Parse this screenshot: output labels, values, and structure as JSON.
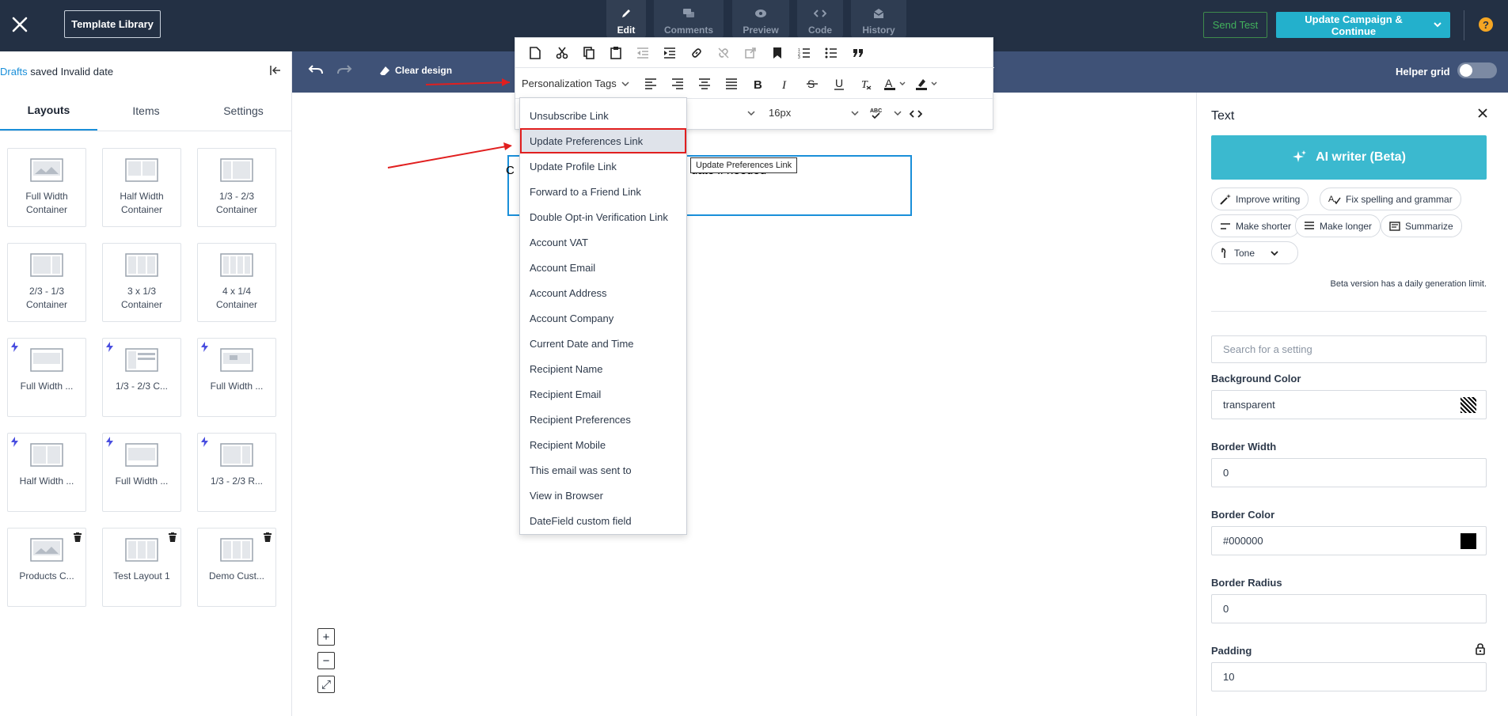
{
  "topbar": {
    "library_label": "Template Library",
    "tabs": [
      {
        "label": "Edit",
        "icon": "pencil-icon"
      },
      {
        "label": "Comments",
        "icon": "comments-icon"
      },
      {
        "label": "Preview",
        "icon": "eye-icon"
      },
      {
        "label": "Code",
        "icon": "code-icon"
      },
      {
        "label": "History",
        "icon": "history-icon"
      }
    ],
    "send_test_label": "Send Test",
    "update_label": "Update Campaign & Continue",
    "help_label": "?"
  },
  "left": {
    "drafts_link": "Drafts",
    "drafts_status": " saved Invalid date",
    "tabs": [
      "Layouts",
      "Items",
      "Settings"
    ],
    "cards": [
      {
        "name": "Full Width Container",
        "lines": [
          "Full Width",
          "Container"
        ]
      },
      {
        "name": "Half Width Container",
        "lines": [
          "Half Width",
          "Container"
        ]
      },
      {
        "name": "1/3 - 2/3 Container",
        "lines": [
          "1/3 - 2/3",
          "Container"
        ]
      },
      {
        "name": "2/3 - 1/3 Container",
        "lines": [
          "2/3 - 1/3",
          "Container"
        ]
      },
      {
        "name": "3 x 1/3 Container",
        "lines": [
          "3 x 1/3",
          "Container"
        ]
      },
      {
        "name": "4 x 1/4 Container",
        "lines": [
          "4 x 1/4",
          "Container"
        ]
      },
      {
        "name": "Full Width ...",
        "lines": [
          "Full Width ..."
        ]
      },
      {
        "name": "1/3 - 2/3 C...",
        "lines": [
          "1/3 - 2/3 C..."
        ]
      },
      {
        "name": "Full Width ...",
        "lines": [
          "Full Width ..."
        ]
      },
      {
        "name": "Half Width ...",
        "lines": [
          "Half Width ..."
        ]
      },
      {
        "name": "Full Width ...",
        "lines": [
          "Full Width ..."
        ]
      },
      {
        "name": "1/3 - 2/3 R...",
        "lines": [
          "1/3 - 2/3 R..."
        ]
      },
      {
        "name": "Products C...",
        "lines": [
          "Products C..."
        ]
      },
      {
        "name": "Test Layout 1",
        "lines": [
          "Test Layout 1"
        ]
      },
      {
        "name": "Demo Cust...",
        "lines": [
          "Demo Cust..."
        ]
      }
    ]
  },
  "canvas": {
    "clear_label": "Clear design",
    "helper_grid_label": "Helper grid",
    "text_content": "date if needed",
    "tooltip": "Update Preferences Link",
    "personalization_label": "Personalization Tags",
    "font_size": "16px",
    "zoom": [
      "+",
      "−",
      "⤢"
    ]
  },
  "dropdown": {
    "items": [
      "Unsubscribe Link",
      "Update Preferences Link",
      "Update Profile Link",
      "Forward to a Friend Link",
      "Double Opt-in Verification Link",
      "Account VAT",
      "Account Email",
      "Account Address",
      "Account Company",
      "Current Date and Time",
      "Recipient Name",
      "Recipient Email",
      "Recipient Preferences",
      "Recipient Mobile",
      "This email was sent to",
      "View in Browser",
      "DateField custom field"
    ],
    "highlighted_index": 1
  },
  "right": {
    "title": "Text",
    "ai_label": "AI writer (Beta)",
    "chips": [
      "Improve writing",
      "Fix spelling and grammar",
      "Make shorter",
      "Make longer",
      "Summarize",
      "Tone"
    ],
    "beta_note": "Beta version has a daily generation limit.",
    "search_placeholder": "Search for a setting",
    "fields": [
      {
        "label": "Background Color",
        "value": "transparent"
      },
      {
        "label": "Border Width",
        "value": "0"
      },
      {
        "label": "Border Color",
        "value": "#000000"
      },
      {
        "label": "Border Radius",
        "value": "0"
      },
      {
        "label": "Padding",
        "value": "10"
      }
    ]
  },
  "colors": {
    "topbar": "#233044",
    "accent": "#23b0cc",
    "canvas_toolbar": "#3f5277",
    "highlight_red": "#e11f1f"
  }
}
